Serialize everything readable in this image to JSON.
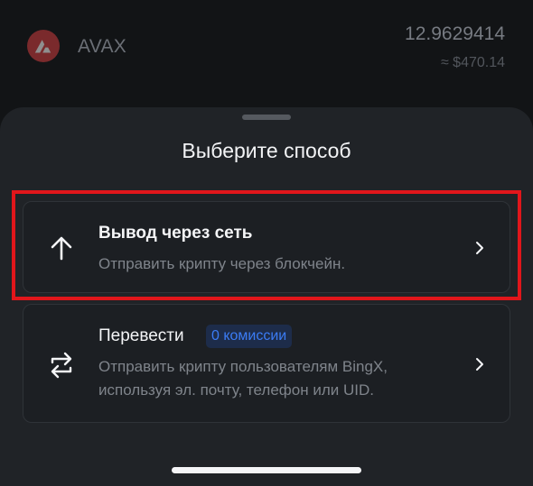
{
  "asset": {
    "name": "AVAX",
    "amount": "12.9629414",
    "fiat": "≈ $470.14",
    "logo_icon": "avalanche-logo-icon",
    "logo_color": "#7a2a2c"
  },
  "sheet": {
    "title": "Выберите способ",
    "options": [
      {
        "title": "Вывод через сеть",
        "description": "Отправить крипту через блокчейн.",
        "icon": "arrow-up-icon",
        "chevron_icon": "chevron-right-icon",
        "highlighted": true
      },
      {
        "title": "Перевести",
        "badge": "0 комиссии",
        "description": "Отправить крипту пользователям BingX, используя эл. почту, телефон или UID.",
        "icon": "transfer-arrows-icon",
        "chevron_icon": "chevron-right-icon"
      }
    ]
  },
  "colors": {
    "highlight_border": "#e1161b",
    "badge_text": "#3b7cf5",
    "badge_bg": "#1d2c4a",
    "sheet_bg": "#202327"
  }
}
